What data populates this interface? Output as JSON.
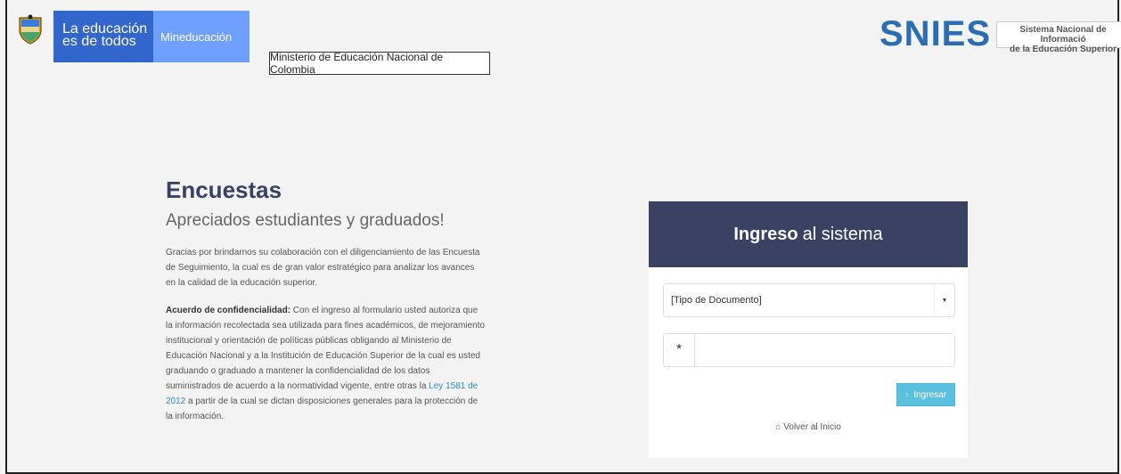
{
  "header": {
    "edu_line1": "La educación",
    "edu_line2": "es de todos",
    "mineducacion": "Mineducación",
    "ministry": "Ministerio de Educación Nacional de Colombia",
    "snies_logo": "SNIES",
    "snies_sub_line1": "Sistema Nacional de Informació",
    "snies_sub_line2": "de la Educación Superior"
  },
  "main": {
    "title": "Encuestas",
    "subtitle": "Apreciados estudiantes y graduados!",
    "intro": "Gracias por brindarnos su colaboración con el diligenciamiento de las Encuesta de Seguimiento, la cual es de gran valor estratégico para analizar los avances en la calidad de la educación superior.",
    "conf_label": "Acuerdo de confidencialidad:",
    "conf_text1": " Con el ingreso al formulario usted autoriza que la información recolectada sea utilizada para fines académicos, de mejoramiento institucional y orientación de políticas públicas obligando al Ministerio de Educación Nacional y a la Institución de Educación Superior de la cual es usted graduando o graduado a mantener la confidencialidad de los datos suministrados de acuerdo a la normatividad vigente, entre otras la ",
    "conf_link": "Ley 1581 de 2012",
    "conf_text2": " a partir de la cual se dictan disposiciones generales para la protección de la información."
  },
  "login": {
    "title_bold": "Ingreso",
    "title_rest": "al sistema",
    "doc_type_selected": "[Tipo de Documento]",
    "doc_number_value": "",
    "asterisk": "*",
    "submit_label": "Ingresar",
    "back_label": "Volver al Inicio"
  },
  "colors": {
    "gov_blue": "#3366cc",
    "gov_light_blue": "#6fa0ff",
    "panel_header": "#3a4163",
    "button": "#5bc0de",
    "snies_blue": "#2a6db5"
  }
}
